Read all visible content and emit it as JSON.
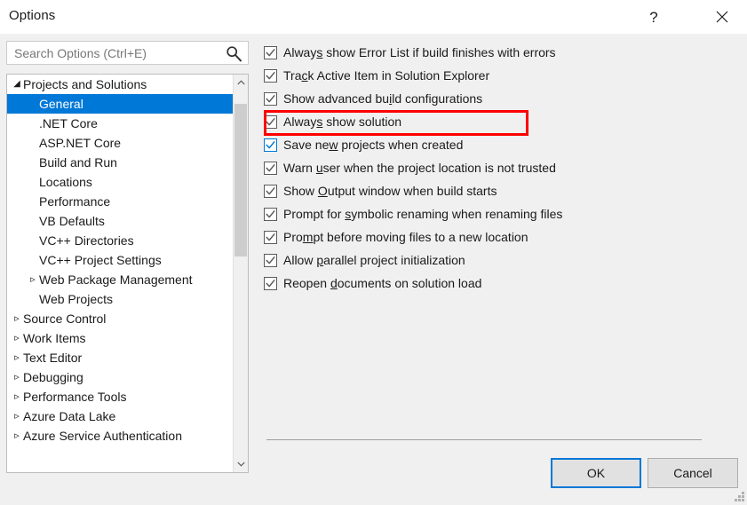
{
  "window": {
    "title": "Options",
    "help_icon": "question-mark-icon",
    "close_icon": "close-icon"
  },
  "search": {
    "placeholder": "Search Options (Ctrl+E)",
    "value": "",
    "icon": "search-icon"
  },
  "tree": {
    "selected": "General",
    "items": [
      {
        "label": "Projects and Solutions",
        "level": 0,
        "state": "expanded",
        "selected": false
      },
      {
        "label": "General",
        "level": 1,
        "state": "leaf",
        "selected": true
      },
      {
        "label": ".NET Core",
        "level": 1,
        "state": "leaf",
        "selected": false
      },
      {
        "label": "ASP.NET Core",
        "level": 1,
        "state": "leaf",
        "selected": false
      },
      {
        "label": "Build and Run",
        "level": 1,
        "state": "leaf",
        "selected": false
      },
      {
        "label": "Locations",
        "level": 1,
        "state": "leaf",
        "selected": false
      },
      {
        "label": "Performance",
        "level": 1,
        "state": "leaf",
        "selected": false
      },
      {
        "label": "VB Defaults",
        "level": 1,
        "state": "leaf",
        "selected": false
      },
      {
        "label": "VC++ Directories",
        "level": 1,
        "state": "leaf",
        "selected": false
      },
      {
        "label": "VC++ Project Settings",
        "level": 1,
        "state": "leaf",
        "selected": false
      },
      {
        "label": "Web Package Management",
        "level": 1,
        "state": "collapsed",
        "selected": false
      },
      {
        "label": "Web Projects",
        "level": 1,
        "state": "leaf",
        "selected": false
      },
      {
        "label": "Source Control",
        "level": 0,
        "state": "collapsed",
        "selected": false
      },
      {
        "label": "Work Items",
        "level": 0,
        "state": "collapsed",
        "selected": false
      },
      {
        "label": "Text Editor",
        "level": 0,
        "state": "collapsed",
        "selected": false
      },
      {
        "label": "Debugging",
        "level": 0,
        "state": "collapsed",
        "selected": false
      },
      {
        "label": "Performance Tools",
        "level": 0,
        "state": "collapsed",
        "selected": false
      },
      {
        "label": "Azure Data Lake",
        "level": 0,
        "state": "collapsed",
        "selected": false
      },
      {
        "label": "Azure Service Authentication",
        "level": 0,
        "state": "collapsed",
        "selected": false
      }
    ],
    "scrollbar": {
      "up_icon": "chevron-up-icon",
      "down_icon": "chevron-down-icon"
    }
  },
  "options": [
    {
      "label": "Always show Error List if build finishes with errors",
      "accel": "s",
      "checked": true,
      "focused": false
    },
    {
      "label": "Track Active Item in Solution Explorer",
      "accel": "c",
      "checked": true,
      "focused": false,
      "highlighted": true
    },
    {
      "label": "Show advanced build configurations",
      "accel": "i",
      "checked": true,
      "focused": false
    },
    {
      "label": "Always show solution",
      "accel": "s",
      "checked": true,
      "focused": false
    },
    {
      "label": "Save new projects when created",
      "accel": "w",
      "checked": true,
      "focused": true
    },
    {
      "label": "Warn user when the project location is not trusted",
      "accel": "u",
      "checked": true,
      "focused": false
    },
    {
      "label": "Show Output window when build starts",
      "accel": "O",
      "checked": true,
      "focused": false
    },
    {
      "label": "Prompt for symbolic renaming when renaming files",
      "accel": "s",
      "checked": true,
      "focused": false
    },
    {
      "label": "Prompt before moving files to a new location",
      "accel": "m",
      "checked": true,
      "focused": false
    },
    {
      "label": "Allow parallel project initialization",
      "accel": "p",
      "checked": true,
      "focused": false
    },
    {
      "label": "Reopen documents on solution load",
      "accel": "d",
      "checked": true,
      "focused": false
    }
  ],
  "footer": {
    "ok_label": "OK",
    "cancel_label": "Cancel"
  },
  "colors": {
    "accent": "#0078d7",
    "highlight": "#ff0000",
    "dialog_bg": "#f0f0f0",
    "selection_bg": "#0078d7"
  }
}
